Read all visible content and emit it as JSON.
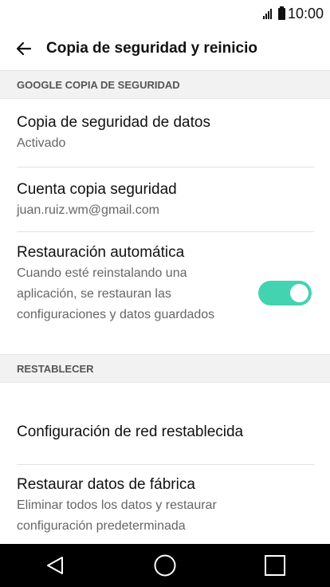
{
  "status_bar": {
    "time": "10:00",
    "signal_icon": "signal-icon",
    "battery_icon": "battery-icon"
  },
  "app_bar": {
    "back_icon": "arrow-left-icon",
    "title": "Copia de seguridad y reinicio"
  },
  "sections": [
    {
      "header": "GOOGLE COPIA DE SEGURIDAD",
      "items": [
        {
          "title": "Copia de seguridad de datos",
          "subtitle": "Activado"
        },
        {
          "title": "Cuenta copia seguridad",
          "subtitle": "juan.ruiz.wm@gmail.com"
        },
        {
          "title": "Restauración automática",
          "subtitle": "Cuando esté reinstalando una aplicación, se restauran las configuraciones y datos guardados",
          "toggle_on": true
        }
      ]
    },
    {
      "header": "RESTABLECER",
      "items": [
        {
          "title": "Configuración de red restablecida"
        },
        {
          "title": "Restaurar datos de fábrica",
          "subtitle": "Eliminar todos los datos y restaurar configuración predeterminada"
        }
      ]
    }
  ],
  "nav_bar": {
    "back": "back-triangle-icon",
    "home": "home-circle-icon",
    "recents": "recents-square-icon"
  },
  "colors": {
    "toggle_on": "#43d3b0",
    "section_bg": "#f2f2f2",
    "nav_bg": "#000000"
  }
}
